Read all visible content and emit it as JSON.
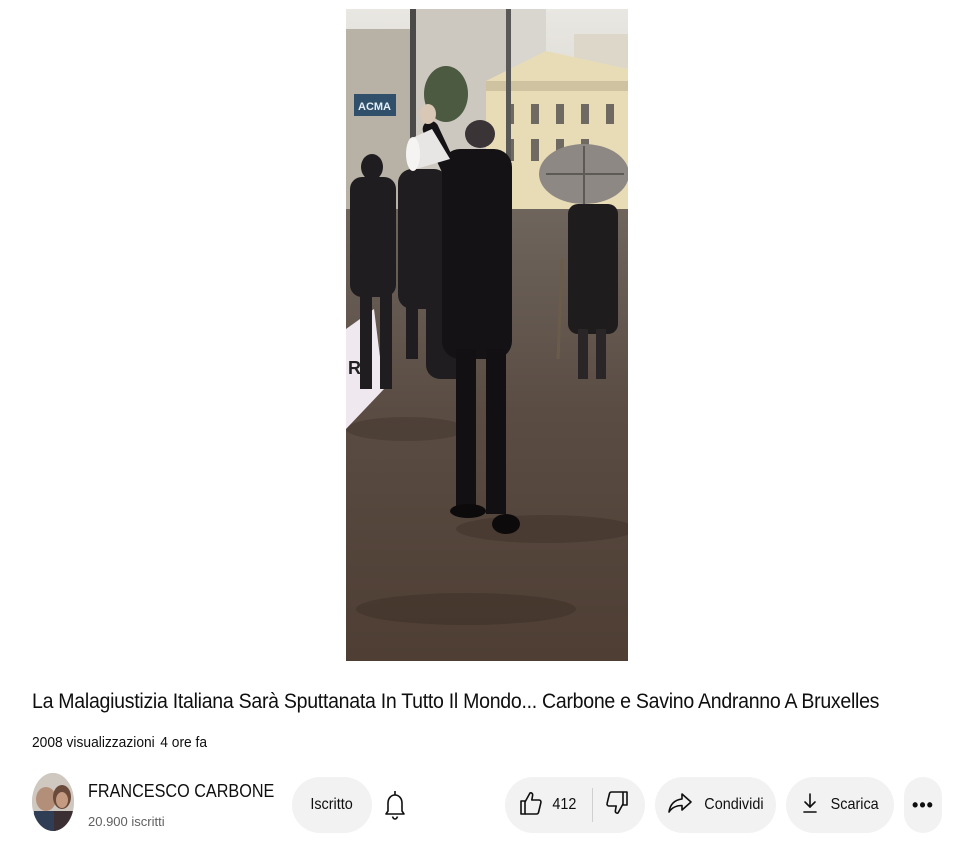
{
  "video": {
    "title": "La Malagiustizia Italiana Sarà Sputtanata In Tutto Il Mondo... Carbone e Savino Andranno A Bruxelles",
    "views": "2008 visualizzazioni",
    "age": "4 ore fa",
    "storefront_sign": "ACMA"
  },
  "channel": {
    "name": "FRANCESCO CARBONE",
    "subscribers": "20.900 iscritti"
  },
  "actions": {
    "subscribe_label": "Iscritto",
    "like_count": "412",
    "share_label": "Condividi",
    "download_label": "Scarica",
    "more_label": "•••"
  },
  "icons": [
    "bell-icon",
    "thumbs-up-icon",
    "thumbs-down-icon",
    "share-arrow-icon",
    "download-icon",
    "more-icon"
  ]
}
